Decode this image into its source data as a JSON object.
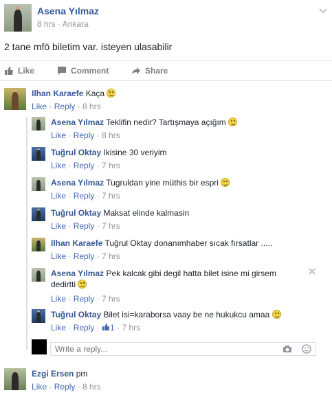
{
  "post": {
    "author": "Asena Yılmaz",
    "time": "8 hrs",
    "sep": " · ",
    "location": "Ankara",
    "text": "2 tane mfö biletim var. isteyen ulasabilir"
  },
  "actions": {
    "like": "Like",
    "comment": "Comment",
    "share": "Share"
  },
  "top_comment": {
    "name": "Ilhan Karaefe",
    "text": "Kaça",
    "like": "Like",
    "reply": "Reply",
    "time": "8 hrs"
  },
  "replies": [
    {
      "name": "Asena Yılmaz",
      "text": "Teklifin nedir? Tartışmaya açığım",
      "emoji": true,
      "like": "Like",
      "reply": "Reply",
      "time": "8 hrs"
    },
    {
      "name": "Tuğrul Oktay",
      "text": "Ikisine 30 veriyim",
      "emoji": false,
      "like": "Like",
      "reply": "Reply",
      "time": "7 hrs"
    },
    {
      "name": "Asena Yılmaz",
      "text": "Tugruldan yine müthis bir espri",
      "emoji": true,
      "like": "Like",
      "reply": "Reply",
      "time": "7 hrs"
    },
    {
      "name": "Tuğrul Oktay",
      "text": "Maksat elinde kalmasin",
      "emoji": false,
      "like": "Like",
      "reply": "Reply",
      "time": "7 hrs"
    },
    {
      "name": "Ilhan Karaefe",
      "text": "Tuğrul Oktay donanımhaber sıcak fırsatlar .....",
      "emoji": false,
      "like": "Like",
      "reply": "Reply",
      "time": "7 hrs"
    },
    {
      "name": "Asena Yılmaz",
      "text": "Pek kalcak gibi degil hatta bilet isine mi girsem",
      "text2": "dedirtti",
      "emoji": true,
      "like": "Like",
      "reply": "Reply",
      "time": "7 hrs"
    },
    {
      "name": "Tuğrul Oktay",
      "text": "Bilet isi=karaborsa vaay be ne hukukcu amaa",
      "emoji": true,
      "like": "Like",
      "reply": "Reply",
      "likes_count": "1",
      "time": "7 hrs"
    }
  ],
  "reply_box": {
    "placeholder": "Write a reply..."
  },
  "last_comment": {
    "name": "Ezgi Ersen",
    "text": "pm",
    "like": "Like",
    "reply": "Reply",
    "time": "8 hrs"
  },
  "colors": {
    "link": "#4267b2",
    "name": "#365899",
    "meta": "#90949c"
  },
  "icons": [
    "chevron-down-icon",
    "like-icon",
    "comment-icon",
    "share-icon",
    "smile-emoji-icon",
    "camera-icon",
    "emoji-icon",
    "close-icon",
    "thumbs-up-icon"
  ]
}
